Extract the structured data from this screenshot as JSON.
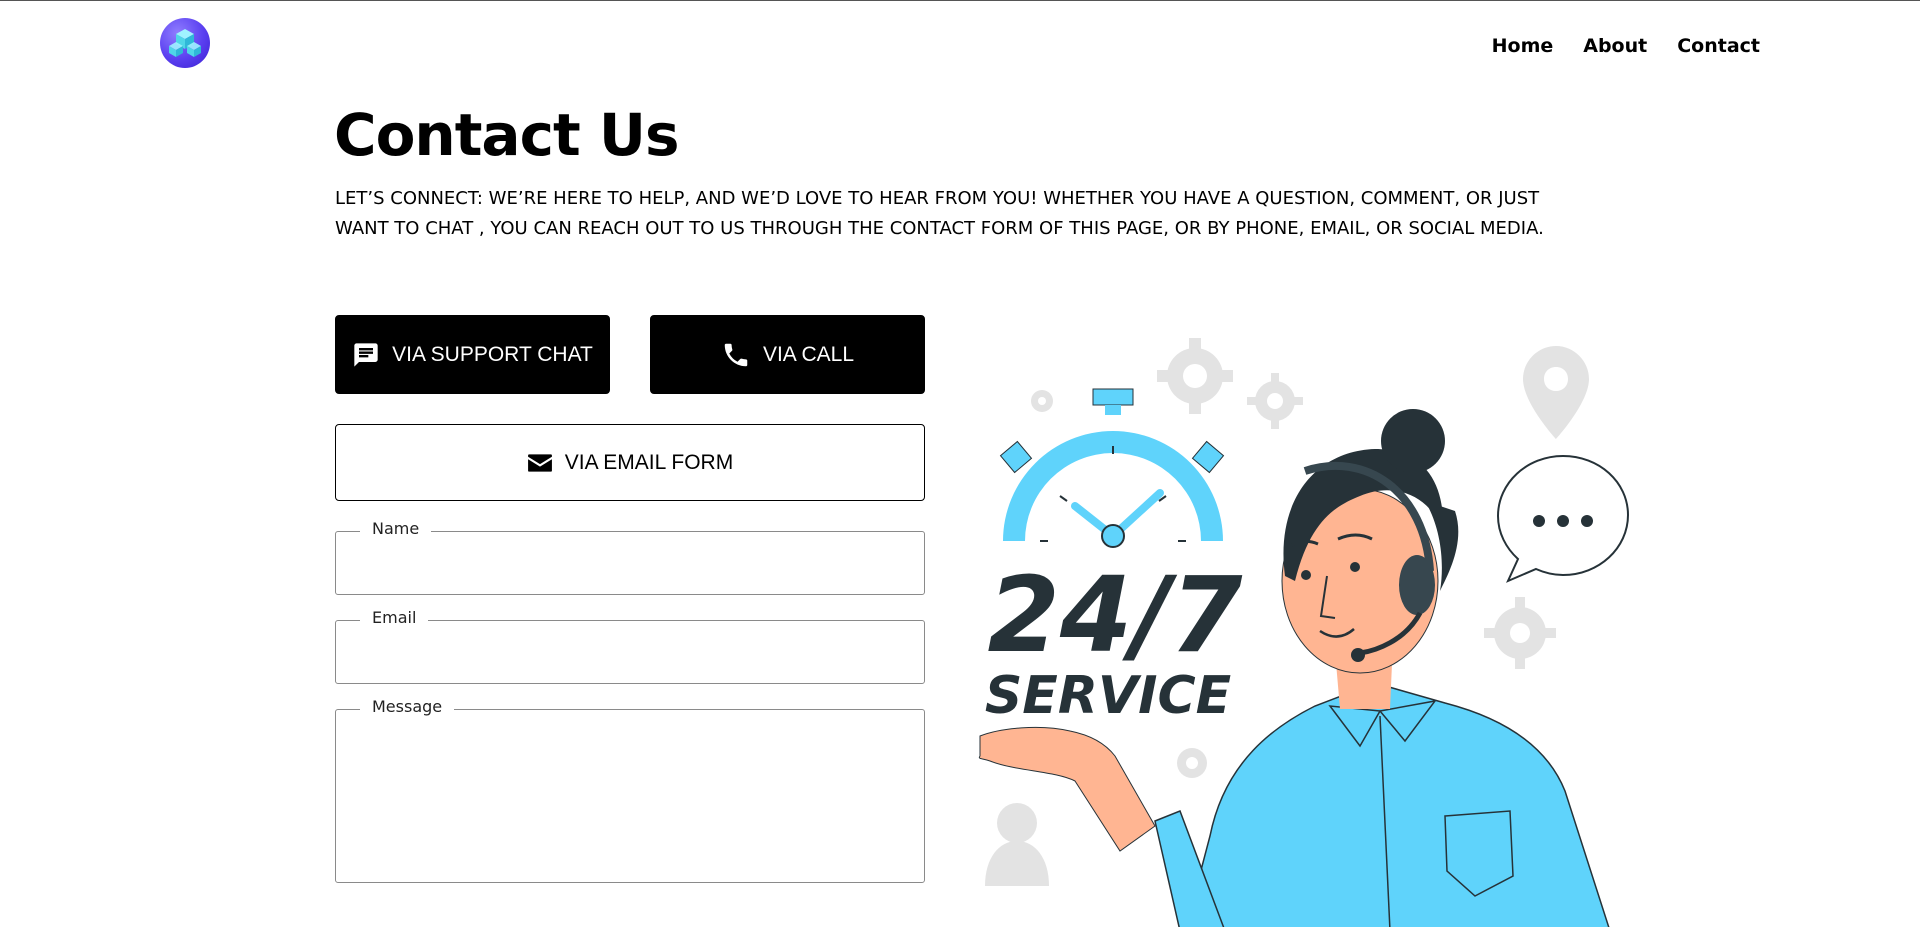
{
  "header": {
    "logo_icon": "cube-logo-icon",
    "nav": [
      {
        "label": "Home"
      },
      {
        "label": "About"
      },
      {
        "label": "Contact"
      }
    ]
  },
  "main": {
    "title": "Contact Us",
    "intro": "LET’S CONNECT: WE’RE HERE TO HELP, AND WE’D LOVE TO HEAR FROM YOU! WHETHER YOU HAVE A QUESTION, COMMENT, OR JUST WANT TO CHAT , YOU CAN REACH OUT TO US THROUGH THE CONTACT FORM OF THIS PAGE, OR BY PHONE, EMAIL, OR SOCIAL MEDIA.",
    "buttons": {
      "support_chat": {
        "label": "VIA SUPPORT CHAT",
        "icon": "chat-icon"
      },
      "call": {
        "label": "VIA CALL",
        "icon": "phone-icon"
      },
      "email_form": {
        "label": "VIA EMAIL FORM",
        "icon": "envelope-icon"
      }
    },
    "form": {
      "name_label": "Name",
      "name_value": "",
      "email_label": "Email",
      "email_value": "",
      "message_label": "Message",
      "message_value": ""
    },
    "illustration": {
      "headline": "24/7",
      "subheadline": "SERVICE"
    }
  },
  "colors": {
    "accent": "#5fd3fb",
    "dark": "#263238",
    "skin": "#ffb592"
  }
}
